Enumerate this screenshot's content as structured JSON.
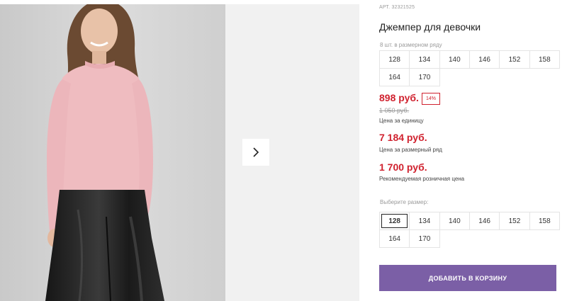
{
  "gallery": {
    "photo_alt": "girl in pink jumper",
    "next_icon": "chevron-right-icon"
  },
  "product": {
    "sku_prefix": "АРТ.",
    "sku": "32321525",
    "title": "Джемпер для девочки"
  },
  "pack": {
    "label": "8 шт. в размерном ряду",
    "sizes": [
      "128",
      "134",
      "140",
      "146",
      "152",
      "158",
      "164",
      "170"
    ]
  },
  "pricing": {
    "price": "898 руб.",
    "discount": "14%",
    "old_price": "1 050 руб.",
    "unit_caption": "Цена за единицу",
    "pack_price": "7 184 руб.",
    "pack_caption": "Цена за размерный ряд",
    "rrp": "1 700 руб.",
    "rrp_caption": "Рекомендуемая розничная цена"
  },
  "size_select": {
    "label": "Выберите размер:",
    "options": [
      "128",
      "134",
      "140",
      "146",
      "152",
      "158",
      "164",
      "170"
    ],
    "selected": "128"
  },
  "cart": {
    "button_label": "ДОБАВИТЬ В КОРЗИНУ"
  },
  "colors": {
    "accent_red": "#d0222f",
    "cart_button": "#7b5fa6"
  }
}
